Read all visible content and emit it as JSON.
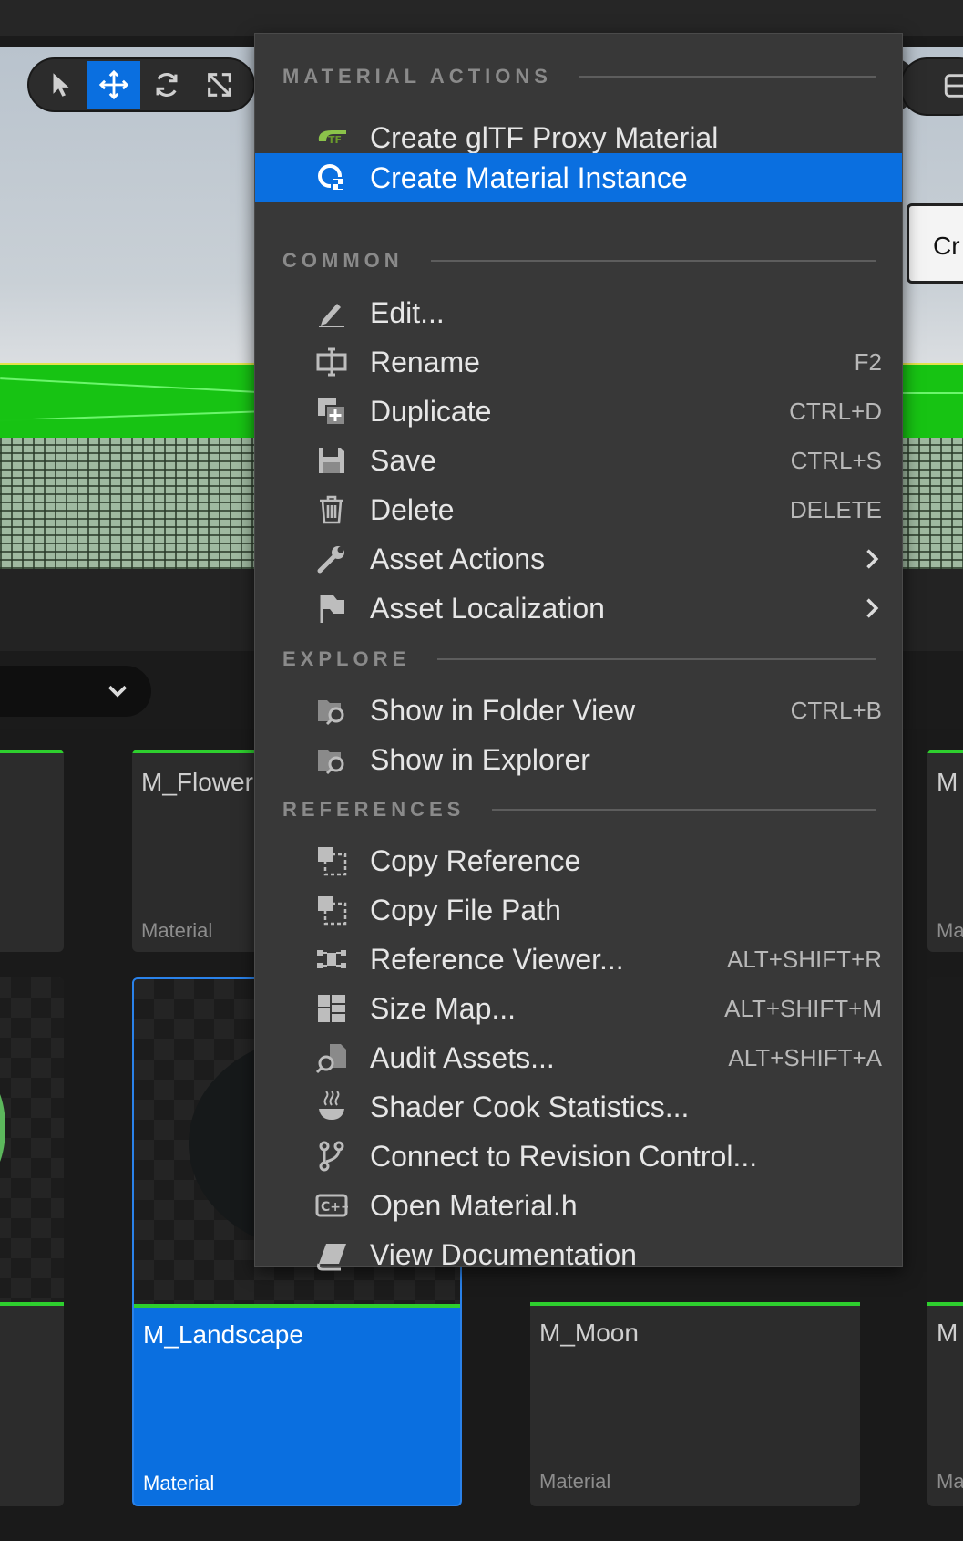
{
  "viewport": {
    "tools": [
      {
        "name": "select-tool",
        "icon": "cursor-icon",
        "active": false
      },
      {
        "name": "translate-tool",
        "icon": "move-arrows-icon",
        "active": true
      },
      {
        "name": "rotate-tool",
        "icon": "rotate-icon",
        "active": false
      },
      {
        "name": "scale-tool",
        "icon": "scale-icon",
        "active": false
      }
    ],
    "partial_button_label": "Cr"
  },
  "content_browser": {
    "tiles": [
      {
        "name": "M_Flower",
        "type": "Material"
      },
      {
        "name": "M_Landscape",
        "type": "Material",
        "selected": true
      },
      {
        "name": "M_Moon",
        "type": "Material"
      },
      {
        "name": "M",
        "type": "Ma"
      },
      {
        "name": "M",
        "type": "Ma"
      }
    ]
  },
  "menu": {
    "sections": {
      "material_actions": "MATERIAL ACTIONS",
      "common": "COMMON",
      "explore": "EXPLORE",
      "references": "REFERENCES"
    },
    "items": {
      "gltf": {
        "label": "Create glTF Proxy Material",
        "icon": "gltf-icon"
      },
      "mat_instance": {
        "label": "Create Material Instance",
        "icon": "material-instance-icon"
      },
      "edit": {
        "label": "Edit...",
        "icon": "pencil-icon"
      },
      "rename": {
        "label": "Rename",
        "shortcut": "F2",
        "icon": "rename-icon"
      },
      "duplicate": {
        "label": "Duplicate",
        "shortcut": "CTRL+D",
        "icon": "duplicate-icon"
      },
      "save": {
        "label": "Save",
        "shortcut": "CTRL+S",
        "icon": "save-icon"
      },
      "delete": {
        "label": "Delete",
        "shortcut": "DELETE",
        "icon": "trash-icon"
      },
      "asset_actions": {
        "label": "Asset Actions",
        "icon": "wrench-icon"
      },
      "asset_localization": {
        "label": "Asset Localization",
        "icon": "flag-icon"
      },
      "folder_view": {
        "label": "Show in Folder View",
        "shortcut": "CTRL+B",
        "icon": "folder-search-icon"
      },
      "explorer": {
        "label": "Show in Explorer",
        "icon": "folder-search-icon"
      },
      "copy_ref": {
        "label": "Copy Reference",
        "icon": "copy-reference-icon"
      },
      "copy_path": {
        "label": "Copy File Path",
        "icon": "copy-path-icon"
      },
      "ref_viewer": {
        "label": "Reference Viewer...",
        "shortcut": "ALT+SHIFT+R",
        "icon": "reference-viewer-icon"
      },
      "size_map": {
        "label": "Size Map...",
        "shortcut": "ALT+SHIFT+M",
        "icon": "size-map-icon"
      },
      "audit": {
        "label": "Audit Assets...",
        "shortcut": "ALT+SHIFT+A",
        "icon": "audit-icon"
      },
      "shader": {
        "label": "Shader Cook Statistics...",
        "icon": "shader-icon"
      },
      "revision": {
        "label": "Connect to Revision Control...",
        "icon": "branch-icon"
      },
      "open_h": {
        "label": "Open Material.h",
        "icon": "cpp-icon"
      },
      "docs": {
        "label": "View Documentation",
        "icon": "book-icon"
      }
    }
  }
}
